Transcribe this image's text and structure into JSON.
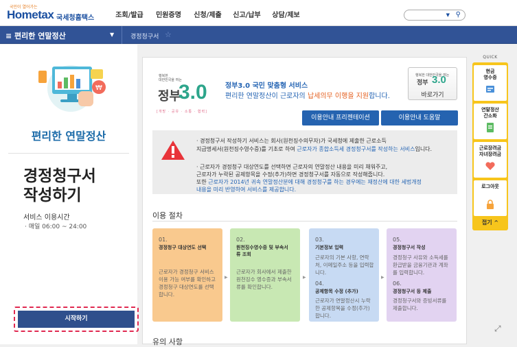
{
  "header": {
    "logo_sub": "국민이 열어가는",
    "logo_main": "Hometax",
    "logo_org": "국세청홈택스",
    "gnb": [
      "조회/발급",
      "민원증명",
      "신청/제출",
      "신고/납부",
      "상담/제보"
    ],
    "search_placeholder": ""
  },
  "navbar": {
    "menu_label": "≡  편리한 연말정산",
    "crumb": "경정청구서"
  },
  "left": {
    "section_title": "편리한 연말정산",
    "page_title_line1": "경정청구서",
    "page_title_line2": "작성하기",
    "service_time_label": "서비스 이용시간",
    "service_hours": "· 매일 06:00 ~ 24:00",
    "start_button": "시작하기"
  },
  "main": {
    "gov_sub": "행복한\n대한민국을 여는",
    "gov_text": "정부",
    "gov_num": "3.0",
    "gov_tags": "[개방 · 공유 · 소통 · 협력]",
    "service_title": "정부3.0  국민 맞춤형 서비스",
    "service_desc_pre": "편리한 연말정산이 근로자의 ",
    "service_desc_em": "납세의무 이행을 지원",
    "service_desc_post": "합니다.",
    "shortcut_top": "행복한 대한민국을 여는",
    "shortcut_text": "정부",
    "shortcut_num": "3.0",
    "shortcut_label": "바로가기",
    "guide_btn1": "이용안내 프리젠테이션",
    "guide_btn2": "이용안내 도움말",
    "notice1_a": "· 경정청구서 작성하기 서비스는 회사(원천징수의무자)가 국세청에 제출한 근로소득",
    "notice1_b": "지급명세서(원천징수영수증)를 기초로 하여 ",
    "notice1_c": "근로자가 종합소득세 경정청구서를 작성하는 서비스",
    "notice1_d": "입니다.",
    "notice2_a": "· 근로자가 경정청구 대상연도를 선택하면 근로자의 연말정산 내용을 미리 채워주고,",
    "notice2_b": "근로자가 누락된 공제항목을 수정(추가)하면 경정청구서를 자동으로 작성해줍니다.",
    "notice2_c": "또한 ",
    "notice2_d": "근로자가 2014년 귀속 연말정산분에 대해 경정청구를 하는 경우에는 재정산에 대한 세법개정",
    "notice2_e": "내용을 미리 반영하여 서비스를 제공합니다.",
    "process_title": "이용 절차",
    "caution_title": "유의 사항",
    "steps": [
      {
        "num": "01.",
        "title": "경정청구 대상연도 선택",
        "desc": "근로자가 경정청구 서비스 이용 가능 여부를 확인하고 경정청구 대상연도를 선택합니다."
      },
      {
        "num": "02.",
        "title": "원천징수영수증 및 부속서류 조회",
        "desc": "근로자가 회사에서 제출한 원천징수 영수증과 부속서류를 확인합니다."
      },
      {
        "num": "03.",
        "title": "기본정보 입력",
        "desc": "근로자의 기본 사항, 연락처, 이메일주소 등을 입력합니다.",
        "num2": "04.",
        "title2": "공제항목 수정 (추가)",
        "desc2": "근로자가 연말정산시 누락한 공제항목을 수정(추가)합니다."
      },
      {
        "num": "05.",
        "title": "경정청구서 작성",
        "desc": "경정청구 사유와 소득세를 환급받을 금융기관과 계좌를 입력합니다.",
        "num2": "06.",
        "title2": "경정청구서 등 제출",
        "desc2": "경정청구서와 증빙서류를 제출합니다."
      }
    ]
  },
  "quick": {
    "head": "QUICK",
    "items": [
      "현금\n영수증",
      "연말정산\n간소화",
      "근로장려금\n자녀장려금",
      "로그아웃"
    ],
    "top": "접기 ^"
  },
  "colors": {
    "primary": "#315396",
    "accent": "#f7c51c",
    "alert": "#e02850"
  }
}
